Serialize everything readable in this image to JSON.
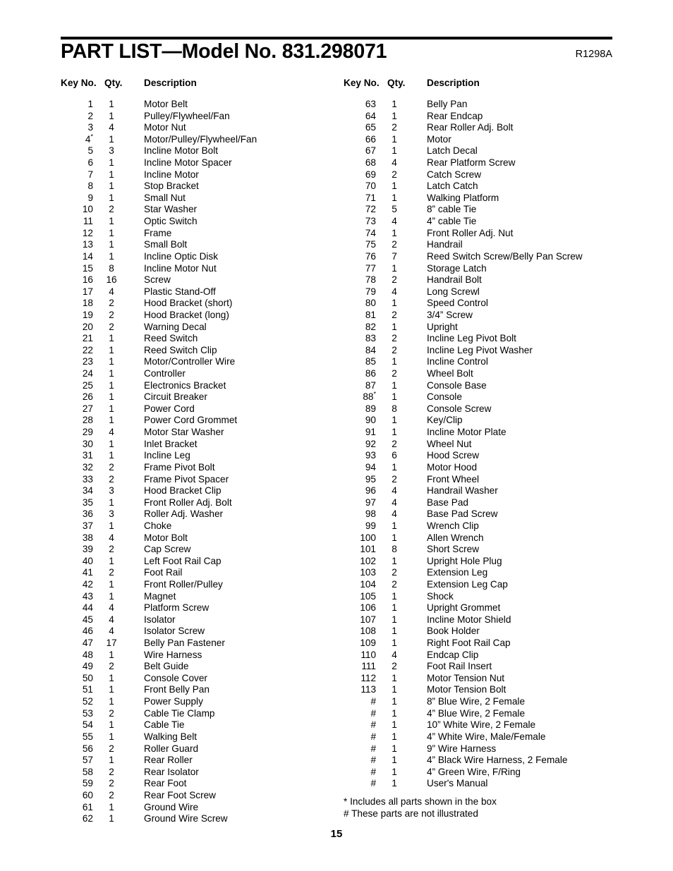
{
  "document": {
    "title": "PART LIST—Model No. 831.298071",
    "revision_code": "R1298A",
    "page_number": "15"
  },
  "columns": {
    "headers": {
      "key_no": "Key No.",
      "qty": "Qty.",
      "description": "Description"
    },
    "left_rows": [
      {
        "key": "1",
        "qty": "1",
        "desc": "Motor Belt"
      },
      {
        "key": "2",
        "qty": "1",
        "desc": "Pulley/Flywheel/Fan"
      },
      {
        "key": "3",
        "qty": "4",
        "desc": "Motor Nut"
      },
      {
        "key": "4*",
        "qty": "1",
        "desc": "Motor/Pulley/Flywheel/Fan"
      },
      {
        "key": "5",
        "qty": "3",
        "desc": "Incline Motor Bolt"
      },
      {
        "key": "6",
        "qty": "1",
        "desc": "Incline Motor Spacer"
      },
      {
        "key": "7",
        "qty": "1",
        "desc": "Incline Motor"
      },
      {
        "key": "8",
        "qty": "1",
        "desc": "Stop Bracket"
      },
      {
        "key": "9",
        "qty": "1",
        "desc": "Small Nut"
      },
      {
        "key": "10",
        "qty": "2",
        "desc": "Star Washer"
      },
      {
        "key": "11",
        "qty": "1",
        "desc": "Optic Switch"
      },
      {
        "key": "12",
        "qty": "1",
        "desc": "Frame"
      },
      {
        "key": "13",
        "qty": "1",
        "desc": "Small Bolt"
      },
      {
        "key": "14",
        "qty": "1",
        "desc": "Incline Optic Disk"
      },
      {
        "key": "15",
        "qty": "8",
        "desc": "Incline Motor Nut"
      },
      {
        "key": "16",
        "qty": "16",
        "desc": "Screw"
      },
      {
        "key": "17",
        "qty": "4",
        "desc": "Plastic Stand-Off"
      },
      {
        "key": "18",
        "qty": "2",
        "desc": "Hood Bracket (short)"
      },
      {
        "key": "19",
        "qty": "2",
        "desc": "Hood Bracket (long)"
      },
      {
        "key": "20",
        "qty": "2",
        "desc": "Warning Decal"
      },
      {
        "key": "21",
        "qty": "1",
        "desc": "Reed Switch"
      },
      {
        "key": "22",
        "qty": "1",
        "desc": "Reed Switch Clip"
      },
      {
        "key": "23",
        "qty": "1",
        "desc": "Motor/Controller Wire"
      },
      {
        "key": "24",
        "qty": "1",
        "desc": "Controller"
      },
      {
        "key": "25",
        "qty": "1",
        "desc": "Electronics Bracket"
      },
      {
        "key": "26",
        "qty": "1",
        "desc": "Circuit Breaker"
      },
      {
        "key": "27",
        "qty": "1",
        "desc": "Power Cord"
      },
      {
        "key": "28",
        "qty": "1",
        "desc": "Power Cord Grommet"
      },
      {
        "key": "29",
        "qty": "4",
        "desc": "Motor Star Washer"
      },
      {
        "key": "30",
        "qty": "1",
        "desc": "Inlet Bracket"
      },
      {
        "key": "31",
        "qty": "1",
        "desc": "Incline Leg"
      },
      {
        "key": "32",
        "qty": "2",
        "desc": "Frame Pivot Bolt"
      },
      {
        "key": "33",
        "qty": "2",
        "desc": "Frame Pivot Spacer"
      },
      {
        "key": "34",
        "qty": "3",
        "desc": "Hood Bracket Clip"
      },
      {
        "key": "35",
        "qty": "1",
        "desc": "Front Roller Adj. Bolt"
      },
      {
        "key": "36",
        "qty": "3",
        "desc": "Roller Adj. Washer"
      },
      {
        "key": "37",
        "qty": "1",
        "desc": "Choke"
      },
      {
        "key": "38",
        "qty": "4",
        "desc": "Motor Bolt"
      },
      {
        "key": "39",
        "qty": "2",
        "desc": "Cap Screw"
      },
      {
        "key": "40",
        "qty": "1",
        "desc": "Left Foot Rail Cap"
      },
      {
        "key": "41",
        "qty": "2",
        "desc": "Foot Rail"
      },
      {
        "key": "42",
        "qty": "1",
        "desc": "Front Roller/Pulley"
      },
      {
        "key": "43",
        "qty": "1",
        "desc": "Magnet"
      },
      {
        "key": "44",
        "qty": "4",
        "desc": "Platform Screw"
      },
      {
        "key": "45",
        "qty": "4",
        "desc": "Isolator"
      },
      {
        "key": "46",
        "qty": "4",
        "desc": "Isolator Screw"
      },
      {
        "key": "47",
        "qty": "17",
        "desc": "Belly Pan Fastener"
      },
      {
        "key": "48",
        "qty": "1",
        "desc": "Wire Harness"
      },
      {
        "key": "49",
        "qty": "2",
        "desc": "Belt Guide"
      },
      {
        "key": "50",
        "qty": "1",
        "desc": "Console Cover"
      },
      {
        "key": "51",
        "qty": "1",
        "desc": "Front Belly Pan"
      },
      {
        "key": "52",
        "qty": "1",
        "desc": "Power Supply"
      },
      {
        "key": "53",
        "qty": "2",
        "desc": "Cable Tie Clamp"
      },
      {
        "key": "54",
        "qty": "1",
        "desc": "Cable Tie"
      },
      {
        "key": "55",
        "qty": "1",
        "desc": "Walking Belt"
      },
      {
        "key": "56",
        "qty": "2",
        "desc": "Roller Guard"
      },
      {
        "key": "57",
        "qty": "1",
        "desc": "Rear Roller"
      },
      {
        "key": "58",
        "qty": "2",
        "desc": "Rear Isolator"
      },
      {
        "key": "59",
        "qty": "2",
        "desc": "Rear Foot"
      },
      {
        "key": "60",
        "qty": "2",
        "desc": "Rear Foot Screw"
      },
      {
        "key": "61",
        "qty": "1",
        "desc": "Ground Wire"
      },
      {
        "key": "62",
        "qty": "1",
        "desc": "Ground Wire Screw"
      }
    ],
    "right_rows": [
      {
        "key": "63",
        "qty": "1",
        "desc": "Belly Pan"
      },
      {
        "key": "64",
        "qty": "1",
        "desc": "Rear Endcap"
      },
      {
        "key": "65",
        "qty": "2",
        "desc": "Rear Roller Adj. Bolt"
      },
      {
        "key": "66",
        "qty": "1",
        "desc": "Motor"
      },
      {
        "key": "67",
        "qty": "1",
        "desc": "Latch Decal"
      },
      {
        "key": "68",
        "qty": "4",
        "desc": "Rear Platform Screw"
      },
      {
        "key": "69",
        "qty": "2",
        "desc": "Catch Screw"
      },
      {
        "key": "70",
        "qty": "1",
        "desc": "Latch Catch"
      },
      {
        "key": "71",
        "qty": "1",
        "desc": "Walking Platform"
      },
      {
        "key": "72",
        "qty": "5",
        "desc": "8” cable Tie"
      },
      {
        "key": "73",
        "qty": "4",
        "desc": "4” cable Tie"
      },
      {
        "key": "74",
        "qty": "1",
        "desc": "Front Roller Adj. Nut"
      },
      {
        "key": "75",
        "qty": "2",
        "desc": "Handrail"
      },
      {
        "key": "76",
        "qty": "7",
        "desc": "Reed Switch Screw/Belly Pan Screw"
      },
      {
        "key": "77",
        "qty": "1",
        "desc": "Storage Latch"
      },
      {
        "key": "78",
        "qty": "2",
        "desc": "Handrail Bolt"
      },
      {
        "key": "79",
        "qty": "4",
        "desc": "Long Screwl"
      },
      {
        "key": "80",
        "qty": "1",
        "desc": "Speed Control"
      },
      {
        "key": "81",
        "qty": "2",
        "desc": "3/4” Screw"
      },
      {
        "key": "82",
        "qty": "1",
        "desc": "Upright"
      },
      {
        "key": "83",
        "qty": "2",
        "desc": "Incline Leg Pivot Bolt"
      },
      {
        "key": "84",
        "qty": "2",
        "desc": "Incline Leg Pivot Washer"
      },
      {
        "key": "85",
        "qty": "1",
        "desc": "Incline Control"
      },
      {
        "key": "86",
        "qty": "2",
        "desc": "Wheel Bolt"
      },
      {
        "key": "87",
        "qty": "1",
        "desc": "Console Base"
      },
      {
        "key": "88*",
        "qty": "1",
        "desc": "Console"
      },
      {
        "key": "89",
        "qty": "8",
        "desc": "Console Screw"
      },
      {
        "key": "90",
        "qty": "1",
        "desc": "Key/Clip"
      },
      {
        "key": "91",
        "qty": "1",
        "desc": "Incline Motor Plate"
      },
      {
        "key": "92",
        "qty": "2",
        "desc": "Wheel Nut"
      },
      {
        "key": "93",
        "qty": "6",
        "desc": "Hood Screw"
      },
      {
        "key": "94",
        "qty": "1",
        "desc": "Motor Hood"
      },
      {
        "key": "95",
        "qty": "2",
        "desc": "Front Wheel"
      },
      {
        "key": "96",
        "qty": "4",
        "desc": "Handrail Washer"
      },
      {
        "key": "97",
        "qty": "4",
        "desc": "Base Pad"
      },
      {
        "key": "98",
        "qty": "4",
        "desc": "Base Pad Screw"
      },
      {
        "key": "99",
        "qty": "1",
        "desc": "Wrench Clip"
      },
      {
        "key": "100",
        "qty": "1",
        "desc": "Allen Wrench"
      },
      {
        "key": "101",
        "qty": "8",
        "desc": "Short Screw"
      },
      {
        "key": "102",
        "qty": "1",
        "desc": "Upright Hole Plug"
      },
      {
        "key": "103",
        "qty": "2",
        "desc": "Extension Leg"
      },
      {
        "key": "104",
        "qty": "2",
        "desc": "Extension Leg Cap"
      },
      {
        "key": "105",
        "qty": "1",
        "desc": "Shock"
      },
      {
        "key": "106",
        "qty": "1",
        "desc": "Upright Grommet"
      },
      {
        "key": "107",
        "qty": "1",
        "desc": "Incline Motor Shield"
      },
      {
        "key": "108",
        "qty": "1",
        "desc": "Book Holder"
      },
      {
        "key": "109",
        "qty": "1",
        "desc": "Right Foot Rail Cap"
      },
      {
        "key": "110",
        "qty": "4",
        "desc": "Endcap Clip"
      },
      {
        "key": "111",
        "qty": "2",
        "desc": "Foot Rail Insert"
      },
      {
        "key": "112",
        "qty": "1",
        "desc": "Motor Tension Nut"
      },
      {
        "key": "113",
        "qty": "1",
        "desc": "Motor Tension Bolt"
      },
      {
        "key": "#",
        "qty": "1",
        "desc": "8” Blue Wire, 2 Female"
      },
      {
        "key": "#",
        "qty": "1",
        "desc": "4” Blue Wire, 2 Female"
      },
      {
        "key": "#",
        "qty": "1",
        "desc": "10” White Wire, 2 Female"
      },
      {
        "key": "#",
        "qty": "1",
        "desc": "4” White Wire, Male/Female"
      },
      {
        "key": "#",
        "qty": "1",
        "desc": "9” Wire Harness"
      },
      {
        "key": "#",
        "qty": "1",
        "desc": "4” Black Wire Harness, 2 Female"
      },
      {
        "key": "#",
        "qty": "1",
        "desc": "4” Green Wire, F/Ring"
      },
      {
        "key": "#",
        "qty": "1",
        "desc": "User's Manual"
      }
    ]
  },
  "footnotes": [
    "* Includes all parts shown in the box",
    "# These parts are not illustrated"
  ]
}
